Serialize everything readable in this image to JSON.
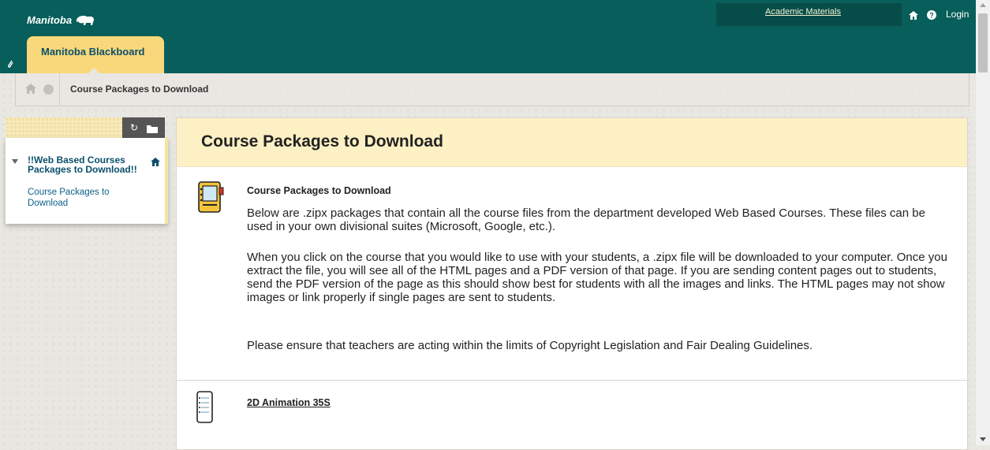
{
  "header": {
    "brand": "Manitoba",
    "tab_label": "Manitoba Blackboard",
    "academic_link": "Academic Materials",
    "login_label": "Login"
  },
  "breadcrumb": {
    "current": "Course Packages to Download"
  },
  "left_menu": {
    "title": "!!Web Based Courses Packages to Download!!",
    "link": "Course Packages to Download"
  },
  "main": {
    "title": "Course Packages to Download",
    "item1": {
      "title": "Course Packages to Download",
      "paragraphs": [
        "Below are .zipx packages that contain all the course files from the department developed Web Based Courses. These files can be used in your own divisional suites (Microsoft, Google, etc.).",
        "When you click on the course that you would like to use with your students, a .zipx file will be downloaded to your computer. Once you extract the file, you will see all of the HTML pages and a PDF version of that page. If you are sending content pages out to students, send the PDF version of the page as this should show best for students with all the images and links. The HTML pages may not show images or link properly if single pages are sent to students.",
        "Please ensure that teachers are acting within the limits of Copyright Legislation and Fair Dealing Guidelines."
      ]
    },
    "item2": {
      "title": "2D Animation 35S"
    }
  },
  "colors": {
    "header_bg": "#075e5a",
    "tab_bg": "#f8d87a",
    "title_band": "#fdf0c4",
    "link": "#0b4f6c"
  },
  "icons": [
    "bison-icon",
    "home-icon",
    "help-icon",
    "paperclip-icon",
    "refresh-icon",
    "folder-icon",
    "content-icon",
    "document-icon"
  ]
}
